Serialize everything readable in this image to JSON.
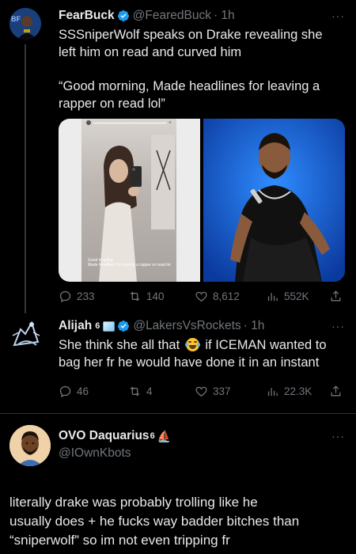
{
  "tweet1": {
    "name": "FearBuck",
    "handle": "@FearedBuck",
    "time": "· 1h",
    "text_line1": "SSSniperWolf speaks on Drake revealing she",
    "text_line2": "left him on read and curved him",
    "quote_line1": "“Good morning, Made headlines for leaving a",
    "quote_line2": "rapper on read lol”",
    "image_caption_line1": "Good morning",
    "image_caption_line2": "Made headlines for leaving a rapper on read lol",
    "replies": "233",
    "reposts": "140",
    "likes": "8,612",
    "views": "552K"
  },
  "tweet2": {
    "name": "Alijah",
    "badge": "6",
    "handle": "@LakersVsRockets",
    "time": "· 1h",
    "text_a": "She think she all that",
    "text_b": "if ICEMAN wanted to",
    "text_line2": "bag her fr he would have done it in an instant",
    "replies": "46",
    "reposts": "4",
    "likes": "337",
    "views": "22.3K"
  },
  "tweet3": {
    "name": "OVO Daquarius",
    "badge": "6",
    "handle": "@IOwnKbots",
    "line1": "literally drake was probably trolling like he",
    "line2": "usually does + he fucks way badder bitches than",
    "line3": "“sniperwolf” so im not even tripping fr"
  },
  "more_label": "···",
  "colors": {
    "background": "#000000",
    "text": "#e7e9ea",
    "muted": "#71767b",
    "verified": "#1d9bf0"
  }
}
